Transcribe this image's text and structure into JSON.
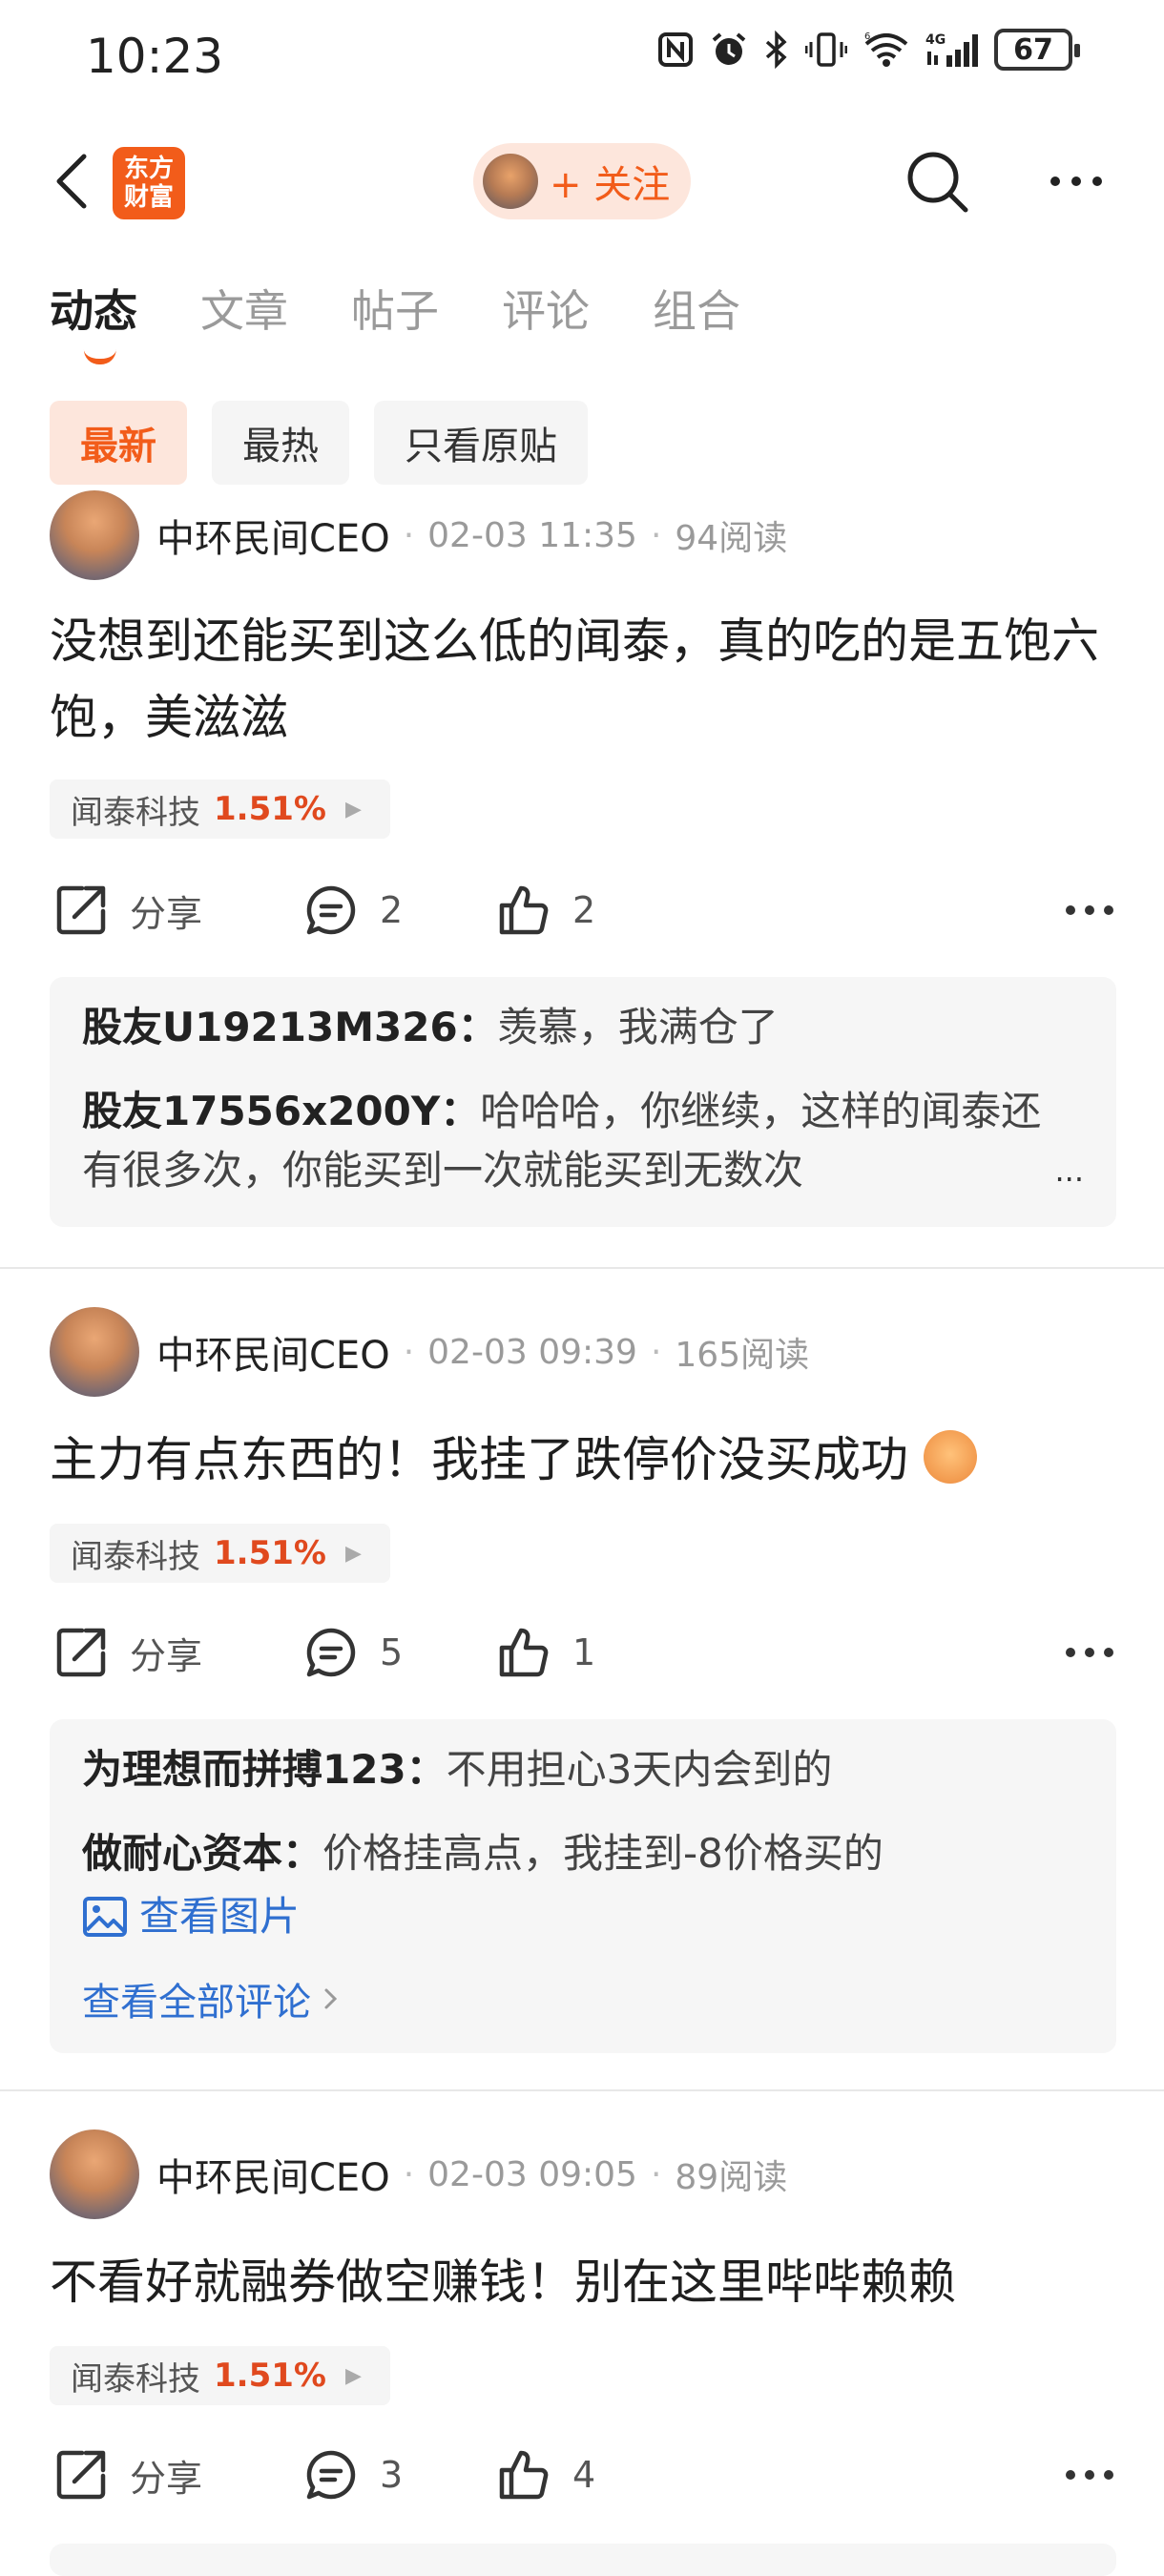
{
  "status_bar": {
    "time": "10:23",
    "icons": [
      "nfc-icon",
      "alarm-icon",
      "bluetooth-icon",
      "vibrate-icon",
      "wifi-icon",
      "4g-signal-icon"
    ],
    "network": "4G",
    "battery": "67"
  },
  "header": {
    "logo_line1": "东方",
    "logo_line2": "财富",
    "follow_label": "+ 关注",
    "accent_color": "#f25c1a"
  },
  "tabs": [
    {
      "label": "动态",
      "active": true
    },
    {
      "label": "文章",
      "active": false
    },
    {
      "label": "帖子",
      "active": false
    },
    {
      "label": "评论",
      "active": false
    },
    {
      "label": "组合",
      "active": false
    }
  ],
  "filters": [
    {
      "label": "最新",
      "active": true
    },
    {
      "label": "最热",
      "active": false
    },
    {
      "label": "只看原贴",
      "active": false
    }
  ],
  "share_label": "分享",
  "posts": [
    {
      "author": "中环民间CEO",
      "datetime": "02-03 11:35",
      "reads": "94阅读",
      "body": "没想到还能买到这么低的闻泰，真的吃的是五饱六饱，美滋滋",
      "stock_name": "闻泰科技",
      "stock_pct": "1.51%",
      "comment_count": "2",
      "like_count": "2",
      "comments": [
        {
          "name": "股友U19213M326：",
          "text": "羡慕，我满仓了"
        },
        {
          "name": "股友17556x200Y：",
          "text": "哈哈哈，你继续，这样的闻泰还有很多次，你能买到一次就能买到无数次",
          "ellipsis": "..."
        }
      ]
    },
    {
      "author": "中环民间CEO",
      "datetime": "02-03 09:39",
      "reads": "165阅读",
      "body": "主力有点东西的！我挂了跌停价没买成功",
      "stock_name": "闻泰科技",
      "stock_pct": "1.51%",
      "comment_count": "5",
      "like_count": "1",
      "comments": [
        {
          "name": "为理想而拼搏123：",
          "text": "不用担心3天内会到的"
        },
        {
          "name": "做耐心资本：",
          "text": "价格挂高点，我挂到-8价格买的"
        }
      ],
      "view_image": "查看图片",
      "view_all": "查看全部评论"
    },
    {
      "author": "中环民间CEO",
      "datetime": "02-03 09:05",
      "reads": "89阅读",
      "body": "不看好就融券做空赚钱！别在这里哔哔赖赖",
      "stock_name": "闻泰科技",
      "stock_pct": "1.51%",
      "comment_count": "3",
      "like_count": "4"
    }
  ]
}
